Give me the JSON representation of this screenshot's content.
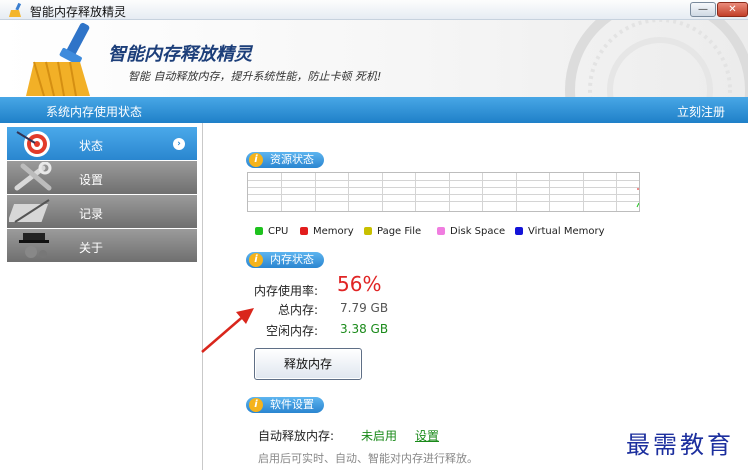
{
  "window": {
    "title": "智能内存释放精灵",
    "minimize_label": "—",
    "close_label": "✕"
  },
  "banner": {
    "brand": "智能内存释放精灵",
    "slogan": "智能 自动释放内存，提升系统性能，防止卡顿 死机!"
  },
  "bluebar": {
    "left_label": "系统内存使用状态",
    "right_label": "立刻注册"
  },
  "sidebar": {
    "items": [
      {
        "label": "状态",
        "icon": "target-icon",
        "active": true
      },
      {
        "label": "设置",
        "icon": "wrench-icon",
        "active": false
      },
      {
        "label": "记录",
        "icon": "record-icon",
        "active": false
      },
      {
        "label": "关于",
        "icon": "about-icon",
        "active": false
      }
    ]
  },
  "resource": {
    "title": "资源状态",
    "legend": [
      {
        "name": "CPU",
        "color": "#1ec21e"
      },
      {
        "name": "Memory",
        "color": "#e21d1d"
      },
      {
        "name": "Page File",
        "color": "#c8c000"
      },
      {
        "name": "Disk Space",
        "color": "#f07de0"
      },
      {
        "name": "Virtual Memory",
        "color": "#1414d8"
      }
    ]
  },
  "memory": {
    "title": "内存状态",
    "usage_label": "内存使用率:",
    "usage_value": "56%",
    "total_label": "总内存:",
    "total_value": "7.79 GB",
    "free_label": "空闲内存:",
    "free_value": "3.38 GB",
    "release_button": "释放内存"
  },
  "software": {
    "title": "软件设置",
    "auto_label": "自动释放内存:",
    "auto_status": "未启用",
    "settings_link": "设置",
    "hint": "启用后可实时、自动、智能对内存进行释放。"
  },
  "watermark": "最需教育",
  "colors": {
    "accent": "#2a86cf",
    "usage": "#e02424",
    "free": "#1a8a1a"
  }
}
